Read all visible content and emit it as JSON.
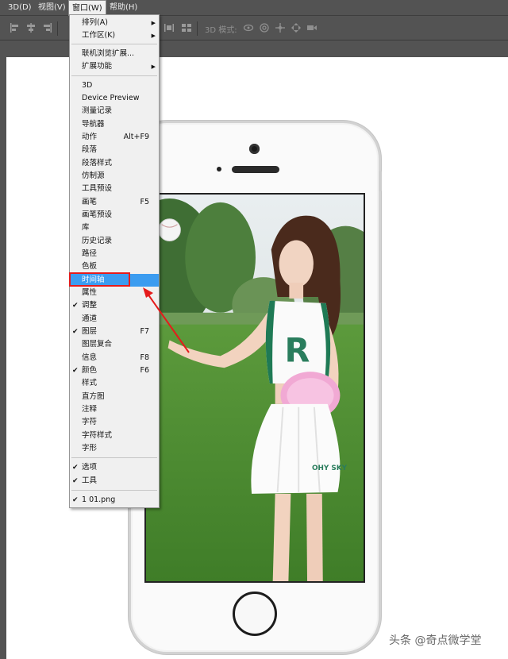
{
  "menubar": {
    "items": [
      {
        "label": "3D(D)",
        "x": 0
      },
      {
        "label": "视图(V)",
        "x": 0
      },
      {
        "label": "窗口(W)",
        "x": 0
      },
      {
        "label": "帮助(H)",
        "x": 0
      }
    ]
  },
  "optionsbar": {
    "mode_label": "3D 模式:"
  },
  "window_menu": {
    "items": [
      {
        "label": "排列(A)",
        "submenu": true
      },
      {
        "label": "工作区(K)",
        "submenu": true
      },
      {
        "label": "联机浏览扩展..."
      },
      {
        "label": "扩展功能",
        "submenu": true
      },
      {
        "label": "3D"
      },
      {
        "label": "Device Preview"
      },
      {
        "label": "测量记录"
      },
      {
        "label": "导航器"
      },
      {
        "label": "动作",
        "shortcut": "Alt+F9"
      },
      {
        "label": "段落"
      },
      {
        "label": "段落样式"
      },
      {
        "label": "仿制源"
      },
      {
        "label": "工具预设"
      },
      {
        "label": "画笔",
        "shortcut": "F5"
      },
      {
        "label": "画笔预设"
      },
      {
        "label": "库"
      },
      {
        "label": "历史记录"
      },
      {
        "label": "路径"
      },
      {
        "label": "色板"
      },
      {
        "label": "时间轴",
        "highlighted": true
      },
      {
        "label": "属性"
      },
      {
        "label": "调整",
        "checked": true
      },
      {
        "label": "通道"
      },
      {
        "label": "图层",
        "shortcut": "F7",
        "checked": true
      },
      {
        "label": "图层复合"
      },
      {
        "label": "信息",
        "shortcut": "F8"
      },
      {
        "label": "颜色",
        "shortcut": "F6",
        "checked": true
      },
      {
        "label": "样式"
      },
      {
        "label": "直方图"
      },
      {
        "label": "注释"
      },
      {
        "label": "字符"
      },
      {
        "label": "字符样式"
      },
      {
        "label": "字形"
      },
      {
        "label": "选项",
        "checked": true
      },
      {
        "label": "工具",
        "checked": true
      },
      {
        "label": "1 01.png",
        "checked": true
      }
    ]
  },
  "shirt_letter": "R",
  "skirt_text": "OHY SKY",
  "watermark": "头条 @奇点微学堂",
  "colors": {
    "highlight": "#3b9cf0",
    "annotation_red": "#e51b1b",
    "app_bg": "#535353"
  }
}
